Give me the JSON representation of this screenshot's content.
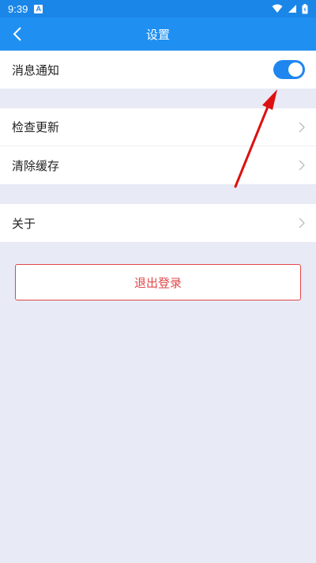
{
  "status_bar": {
    "time": "9:39",
    "notification_icon": "A"
  },
  "appbar": {
    "title": "设置"
  },
  "settings": {
    "notifications_label": "消息通知",
    "notifications_enabled": true,
    "check_update_label": "检查更新",
    "clear_cache_label": "清除缓存",
    "about_label": "关于"
  },
  "logout_label": "退出登录",
  "colors": {
    "accent": "#1f90f2",
    "danger": "#e04848",
    "annotation": "#dd1111"
  }
}
